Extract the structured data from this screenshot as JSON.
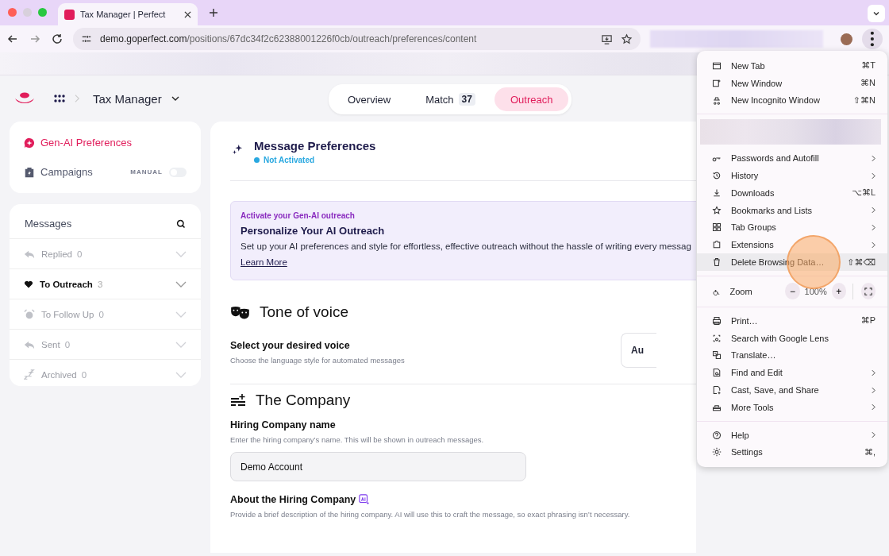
{
  "browser": {
    "tab_title": "Tax Manager | Perfect",
    "url_host": "demo.goperfect.com",
    "url_path": "/positions/67dc34f2c62388001226f0cb/outreach/preferences/content"
  },
  "header": {
    "breadcrumb": "Tax Manager",
    "tabs": [
      {
        "label": "Overview",
        "selected": false
      },
      {
        "label": "Match",
        "badge": "37",
        "selected": false
      },
      {
        "label": "Outreach",
        "selected": true
      }
    ]
  },
  "sidebar": {
    "nav": [
      {
        "kind": "ai",
        "label": "Gen-AI Preferences",
        "selected": true
      },
      {
        "kind": "campaigns",
        "label": "Campaigns",
        "selected": false,
        "toggle_label": "MANUAL",
        "on": false
      }
    ],
    "messages_title": "Messages",
    "folders": [
      {
        "kind": "reply",
        "label": "Replied",
        "count": "0",
        "disabled": true
      },
      {
        "kind": "heart",
        "label": "To Outreach",
        "count": "3",
        "disabled": false
      },
      {
        "kind": "alarm",
        "label": "To Follow Up",
        "count": "0",
        "disabled": true
      },
      {
        "kind": "reply",
        "label": "Sent",
        "count": "0",
        "disabled": true
      },
      {
        "kind": "sleep",
        "label": "Archived",
        "count": "0",
        "disabled": true
      }
    ]
  },
  "main": {
    "title": "Message Preferences",
    "status": "Not Activated",
    "banner": {
      "eyebrow": "Activate your Gen-AI outreach",
      "title": "Personalize Your AI Outreach",
      "text": "Set up your AI preferences and style for effortless, effective outreach without the hassle of writing every messag",
      "link": "Learn More"
    },
    "tone": {
      "title": "Tone of voice",
      "label": "Select your desired voice",
      "hint": "Choose the language style for automated messages",
      "select_value": "Au"
    },
    "company": {
      "title": "The Company",
      "name_label": "Hiring Company name",
      "name_hint": "Enter the hiring company’s name. This will be shown in outreach messages.",
      "name_value": "Demo Account",
      "about_label": "About the Hiring Company",
      "about_hint": "Provide a brief description of the hiring company. AI will use this to craft the message, so exact phrasing isn’t necessary."
    }
  },
  "menu": {
    "groups": [
      [
        {
          "kind": "item",
          "label": "New Tab",
          "shortcut": "⌘T",
          "submenu": false,
          "selected": false
        },
        {
          "kind": "item",
          "label": "New Window",
          "shortcut": "⌘N",
          "submenu": false,
          "selected": false
        },
        {
          "kind": "item",
          "label": "New Incognito Window",
          "shortcut": "⇧⌘N",
          "submenu": false,
          "selected": false
        }
      ],
      [
        {
          "kind": "blurred"
        },
        {
          "kind": "item",
          "label": "Passwords and Autofill",
          "submenu": true,
          "selected": false
        },
        {
          "kind": "item",
          "label": "History",
          "submenu": true,
          "selected": false
        },
        {
          "kind": "item",
          "label": "Downloads",
          "shortcut": "⌥⌘L",
          "submenu": false,
          "selected": false
        },
        {
          "kind": "item",
          "label": "Bookmarks and Lists",
          "submenu": true,
          "selected": false
        },
        {
          "kind": "item",
          "label": "Tab Groups",
          "submenu": true,
          "selected": false
        },
        {
          "kind": "item",
          "label": "Extensions",
          "submenu": true,
          "selected": false
        },
        {
          "kind": "item",
          "label": "Delete Browsing Data…",
          "shortcut": "⇧⌘⌫",
          "submenu": false,
          "selected": true
        }
      ],
      [
        {
          "kind": "zoom",
          "label": "Zoom",
          "minus": "−",
          "value": "100%",
          "plus": "+"
        }
      ],
      [
        {
          "kind": "item",
          "label": "Print…",
          "shortcut": "⌘P",
          "submenu": false,
          "selected": false
        },
        {
          "kind": "item",
          "label": "Search with Google Lens",
          "submenu": false,
          "selected": false
        },
        {
          "kind": "item",
          "label": "Translate…",
          "submenu": false,
          "selected": false
        },
        {
          "kind": "item",
          "label": "Find and Edit",
          "submenu": true,
          "selected": false
        },
        {
          "kind": "item",
          "label": "Cast, Save, and Share",
          "submenu": true,
          "selected": false
        },
        {
          "kind": "item",
          "label": "More Tools",
          "submenu": true,
          "selected": false
        }
      ],
      [
        {
          "kind": "item",
          "label": "Help",
          "submenu": true,
          "selected": false
        },
        {
          "kind": "item",
          "label": "Settings",
          "shortcut": "⌘,",
          "submenu": false,
          "selected": false
        }
      ]
    ]
  }
}
